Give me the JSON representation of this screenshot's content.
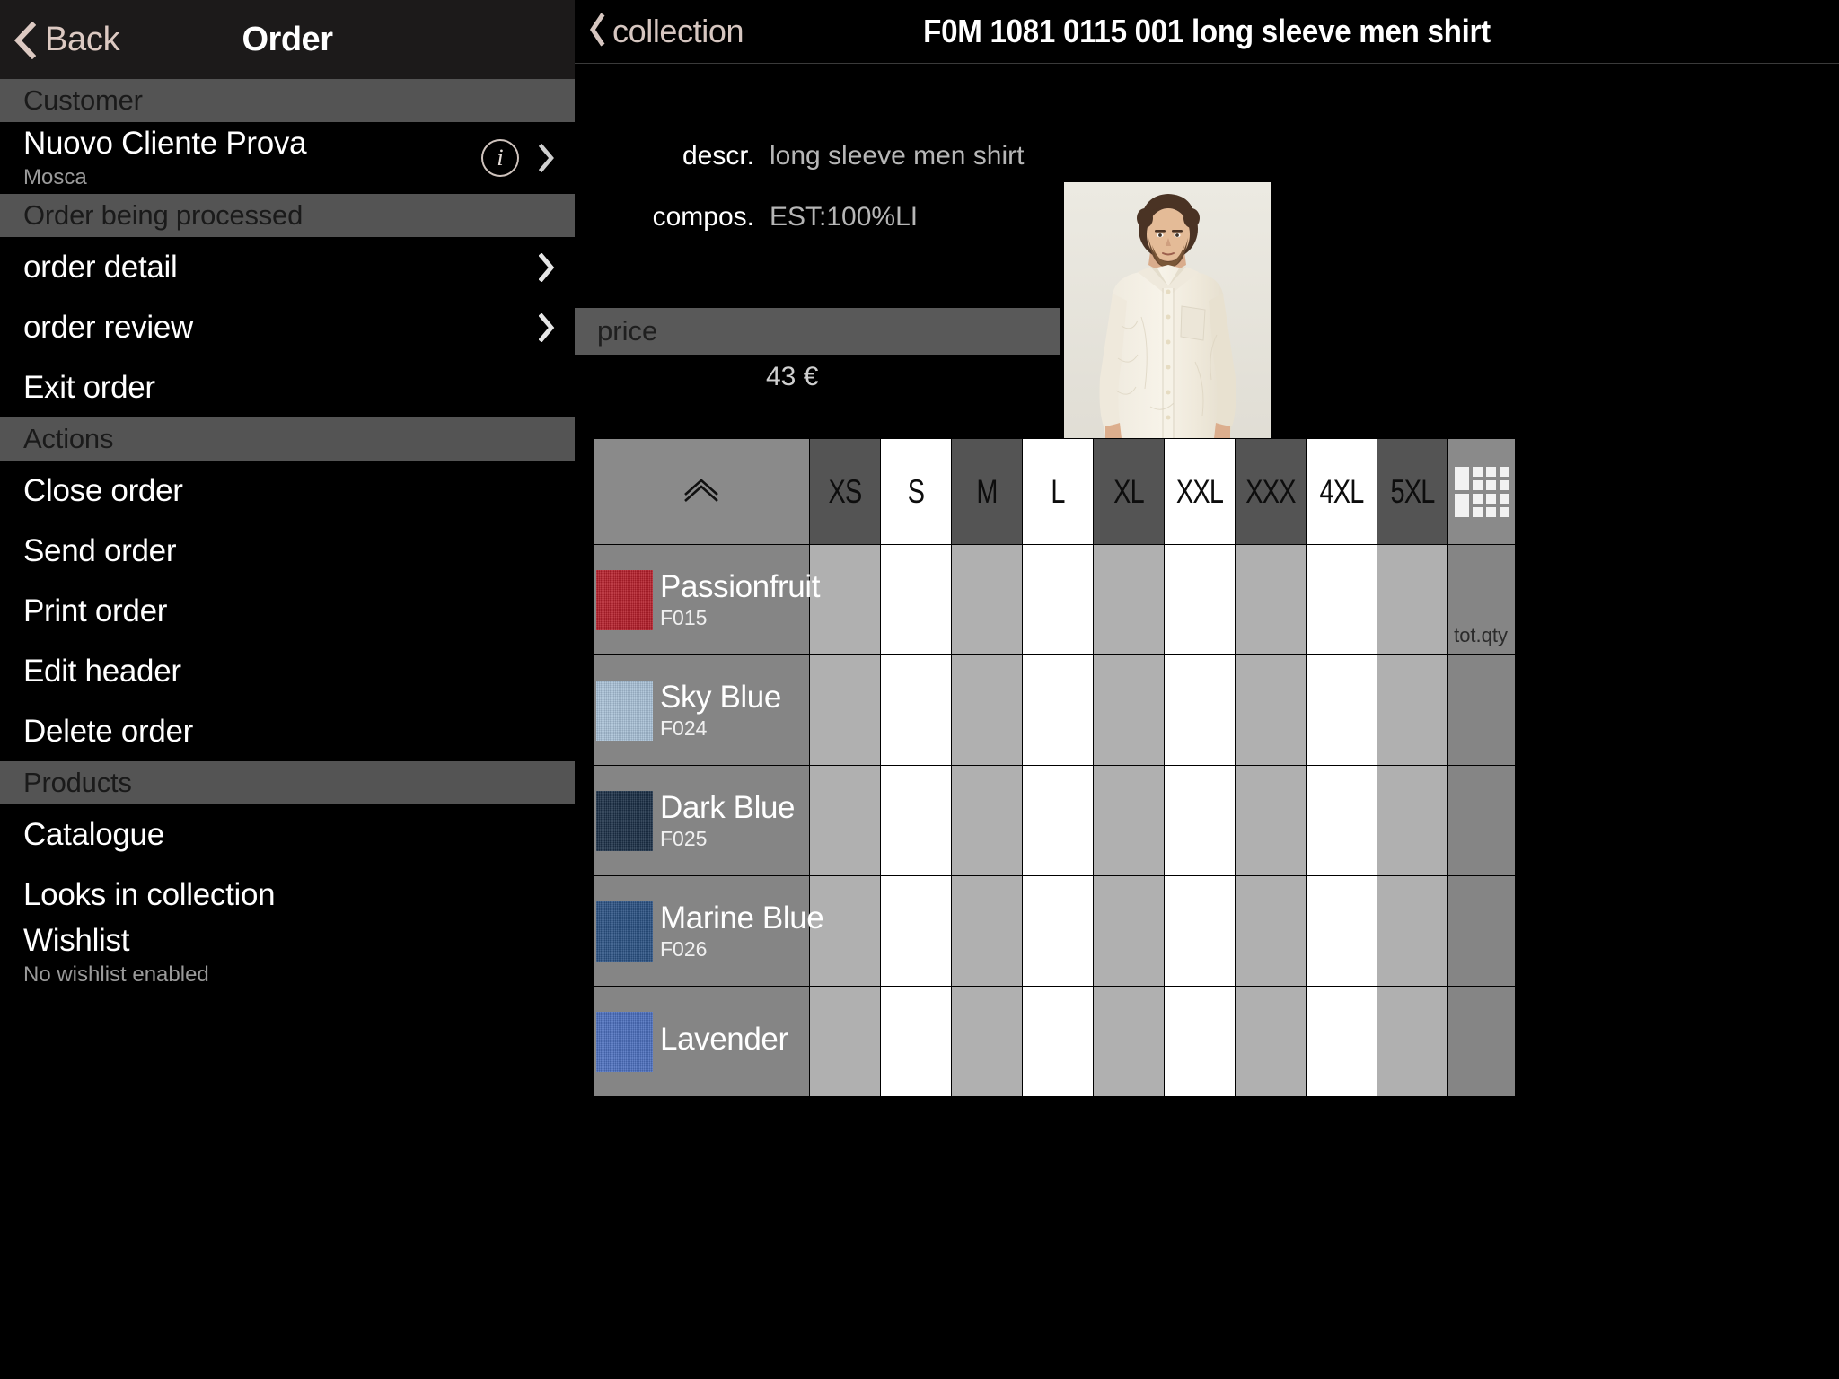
{
  "sidebar": {
    "navbar": {
      "back_label": "Back",
      "title": "Order",
      "back_icon": "chevron-left-icon"
    },
    "sections": [
      {
        "header": "Customer",
        "items": [
          {
            "title": "Nuovo Cliente Prova",
            "subtitle": "Mosca",
            "accessory": "info-and-chevron"
          }
        ]
      },
      {
        "header": "Order being processed",
        "items": [
          {
            "title": "order detail",
            "subtitle": "",
            "accessory": "chevron"
          },
          {
            "title": "order review",
            "subtitle": "",
            "accessory": "chevron"
          },
          {
            "title": "Exit order",
            "subtitle": "",
            "accessory": "none"
          }
        ]
      },
      {
        "header": "Actions",
        "items": [
          {
            "title": "Close order",
            "subtitle": "",
            "accessory": "none"
          },
          {
            "title": "Send order",
            "subtitle": "",
            "accessory": "none"
          },
          {
            "title": "Print order",
            "subtitle": "",
            "accessory": "none"
          },
          {
            "title": "Edit header",
            "subtitle": "",
            "accessory": "none"
          },
          {
            "title": "Delete order",
            "subtitle": "",
            "accessory": "none"
          }
        ]
      },
      {
        "header": "Products",
        "items": [
          {
            "title": "Catalogue",
            "subtitle": "",
            "accessory": "none"
          },
          {
            "title": "Looks in collection",
            "subtitle": "",
            "accessory": "none"
          },
          {
            "title": "Wishlist",
            "subtitle": "No wishlist enabled",
            "accessory": "none"
          }
        ]
      }
    ]
  },
  "product": {
    "navbar": {
      "back_label": "collection",
      "title": "F0M 1081 0115 001 long sleeve men shirt",
      "back_icon": "chevron-left-icon"
    },
    "fields": [
      {
        "label": "descr.",
        "value": "long sleeve men shirt"
      },
      {
        "label": "compos.",
        "value": "EST:100%LI"
      }
    ],
    "price_section_label": "price",
    "price_value": "43 €",
    "photo_alt": "model wearing cream long sleeve linen shirt"
  },
  "size_table": {
    "collapse_icon": "double-chevron-up-icon",
    "grid_icon": "grid-icon",
    "total_label": "tot.qty",
    "sizes": [
      "XS",
      "S",
      "M",
      "L",
      "XL",
      "XXL",
      "XXX",
      "4XL",
      "5XL"
    ],
    "rows": [
      {
        "name": "Passionfruit",
        "code": "F015",
        "swatch": "#b51f2b",
        "quantities": [
          "",
          "",
          "",
          "",
          "",
          "",
          "",
          "",
          ""
        ],
        "total": ""
      },
      {
        "name": "Sky Blue",
        "code": "F024",
        "swatch": "#a8c0d6",
        "quantities": [
          "",
          "",
          "",
          "",
          "",
          "",
          "",
          "",
          ""
        ],
        "total": ""
      },
      {
        "name": "Dark Blue",
        "code": "F025",
        "swatch": "#1b2f46",
        "quantities": [
          "",
          "",
          "",
          "",
          "",
          "",
          "",
          "",
          ""
        ],
        "total": ""
      },
      {
        "name": "Marine Blue",
        "code": "F026",
        "swatch": "#2a5183",
        "quantities": [
          "",
          "",
          "",
          "",
          "",
          "",
          "",
          "",
          ""
        ],
        "total": ""
      },
      {
        "name": "Lavender",
        "code": "",
        "swatch": "#4c6fbe",
        "quantities": [
          "",
          "",
          "",
          "",
          "",
          "",
          "",
          "",
          ""
        ],
        "total": ""
      }
    ]
  },
  "colors": {
    "accent": "#dcc9c2",
    "section_header_bg": "#545454",
    "table_header_dark": "#545454",
    "table_row_light": "#b0b0b0",
    "name_cell_bg": "#858585"
  }
}
